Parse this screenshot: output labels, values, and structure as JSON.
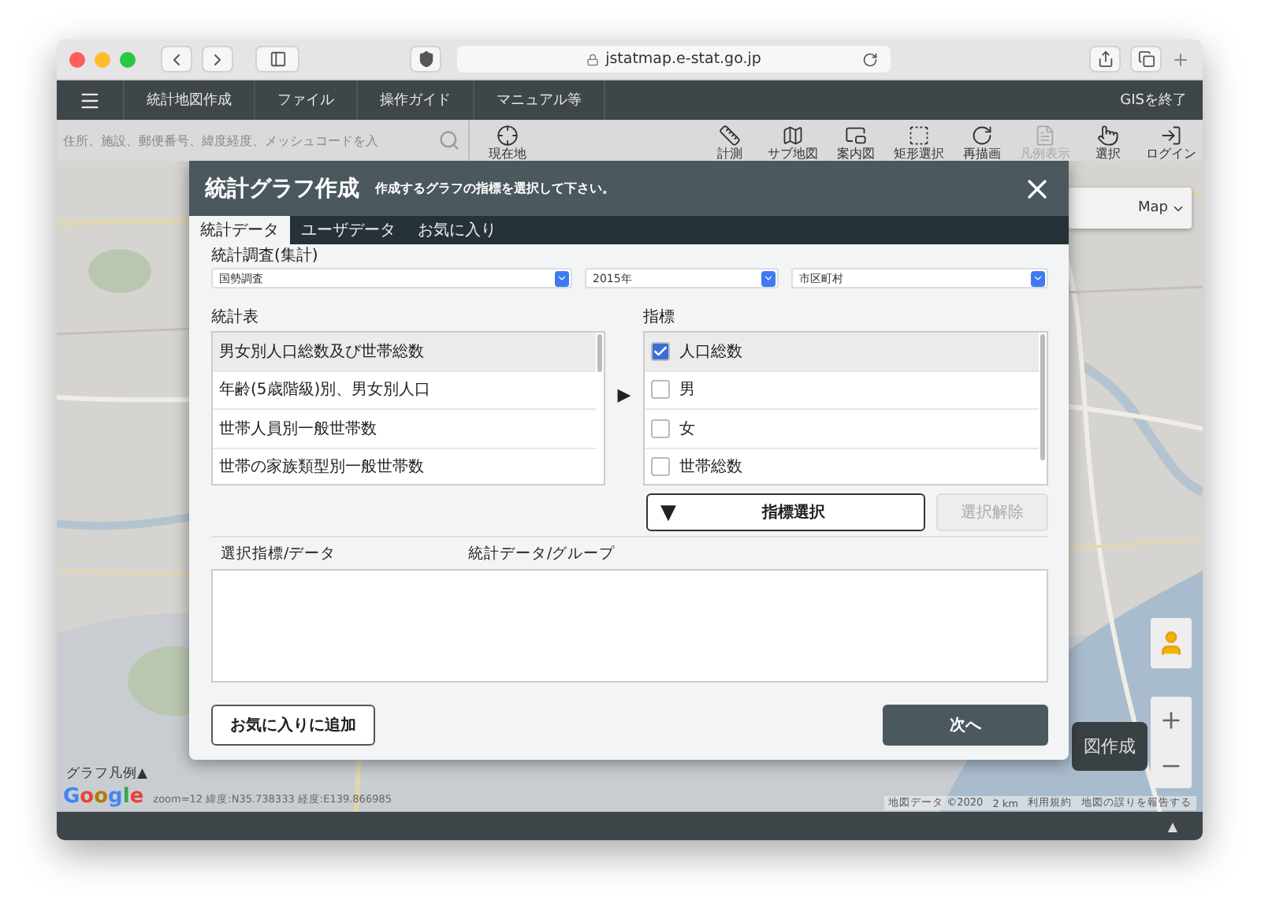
{
  "browser": {
    "url": "jstatmap.e-stat.go.jp"
  },
  "menu_bar": {
    "items": [
      "統計地図作成",
      "ファイル",
      "操作ガイド",
      "マニュアル等"
    ],
    "exit": "GISを終了"
  },
  "toolbar": {
    "search": {
      "placeholder": "住所、施設、郵便番号、緯度経度、メッシュコードを入"
    },
    "locate": {
      "label": "現在地",
      "kind": "crosshair"
    },
    "tools": [
      {
        "label": "計測",
        "kind": "ruler",
        "disabled": false
      },
      {
        "label": "サブ地図",
        "kind": "map",
        "disabled": false
      },
      {
        "label": "案内図",
        "kind": "inset",
        "disabled": false
      },
      {
        "label": "矩形選択",
        "kind": "marquee",
        "disabled": false
      },
      {
        "label": "再描画",
        "kind": "redraw",
        "disabled": false
      },
      {
        "label": "凡例表示",
        "kind": "legend",
        "disabled": true
      },
      {
        "label": "選択",
        "kind": "pointer",
        "disabled": false
      },
      {
        "label": "ログイン",
        "kind": "login",
        "disabled": false
      }
    ]
  },
  "map": {
    "map_type": "Map",
    "create_button": "図作成",
    "legend_toggle": "グラフ凡例▲",
    "logo": "Google",
    "coords": "zoom=12  緯度:N35.738333  経度:E139.866985",
    "attribution": [
      "地図データ ©2020",
      "2 km",
      "利用規約",
      "地図の誤りを報告する"
    ]
  },
  "dialog": {
    "title": "統計グラフ作成",
    "subtitle": "作成するグラフの指標を選択して下さい。",
    "tabs": [
      {
        "label": "統計データ",
        "selected": true
      },
      {
        "label": "ユーザデータ",
        "selected": false
      },
      {
        "label": "お気に入り",
        "selected": false
      }
    ],
    "survey_label": "統計調査(集計)",
    "selects": [
      {
        "value": "国勢調査"
      },
      {
        "value": "2015年"
      },
      {
        "value": "市区町村"
      }
    ],
    "table_label": "統計表",
    "tables": [
      {
        "label": "男女別人口総数及び世帯総数",
        "selected": true
      },
      {
        "label": "年齢(5歳階級)別、男女別人口",
        "selected": false
      },
      {
        "label": "世帯人員別一般世帯数",
        "selected": false
      },
      {
        "label": "世帯の家族類型別一般世帯数",
        "selected": false
      }
    ],
    "move_arrow": "▶",
    "indicator_label": "指標",
    "indicators": [
      {
        "label": "人口総数",
        "checked": true,
        "selected": true
      },
      {
        "label": "男",
        "checked": false,
        "selected": false
      },
      {
        "label": "女",
        "checked": false,
        "selected": false
      },
      {
        "label": "世帯総数",
        "checked": false,
        "selected": false
      }
    ],
    "select_button": {
      "arrow": "▼",
      "label": "指標選択"
    },
    "clear_button": {
      "label": "選択解除",
      "disabled": true
    },
    "columns": [
      "選択指標/データ",
      "統計データ/グループ"
    ],
    "favorite_button": "お気に入りに追加",
    "next_button": "次へ"
  },
  "status_bar": {
    "toggle": "▲"
  }
}
